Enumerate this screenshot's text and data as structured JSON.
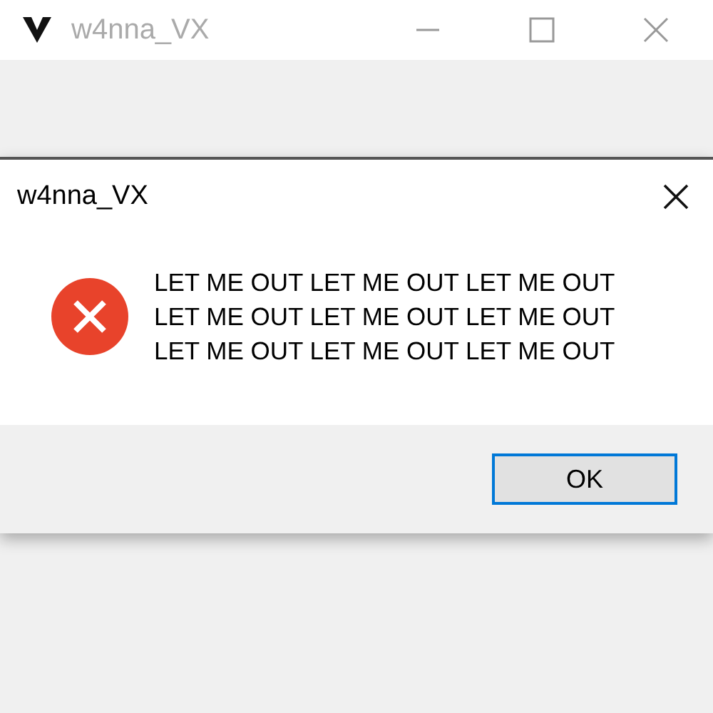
{
  "background_window": {
    "title": "w4nna_VX",
    "active": false
  },
  "dialog": {
    "title": "w4nna_VX",
    "kind": "error",
    "message_lines": [
      "LET ME OUT LET ME OUT LET ME OUT",
      "LET ME OUT LET ME OUT LET ME OUT",
      "LET ME OUT LET ME OUT LET ME OUT"
    ],
    "buttons": [
      {
        "label": "OK",
        "default": true
      }
    ]
  }
}
